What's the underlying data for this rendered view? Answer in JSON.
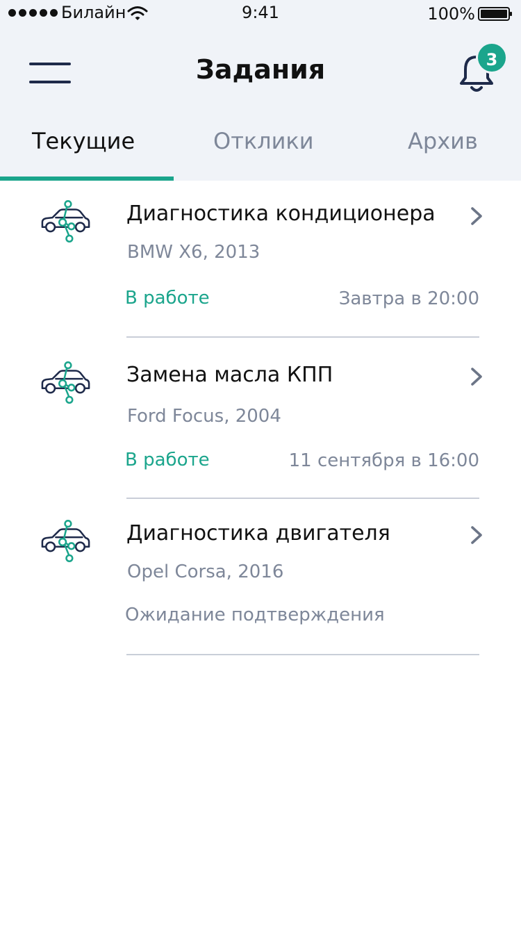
{
  "status_bar": {
    "carrier": "Билайн",
    "time": "9:41",
    "battery": "100%"
  },
  "header": {
    "title": "Задания",
    "notification_count": "3"
  },
  "tabs": [
    {
      "label": "Текущие",
      "active": true
    },
    {
      "label": "Отклики",
      "active": false
    },
    {
      "label": "Архив",
      "active": false
    }
  ],
  "tasks": [
    {
      "title": "Диагностика кондиционера",
      "car": "BMW X6, 2013",
      "status": "В работе",
      "time": "Завтра в 20:00",
      "icon": "car-diagnostics-icon"
    },
    {
      "title": "Замена масла КПП",
      "car": "Ford Focus, 2004",
      "status": "В работе",
      "time": "11 сентября в 16:00",
      "icon": "car-diagnostics-icon"
    },
    {
      "title": "Диагностика двигателя",
      "car": "Opel Corsa, 2016",
      "status": "Ожидание подтверждения",
      "time": "",
      "icon": "car-diagnostics-icon"
    }
  ],
  "colors": {
    "accent": "#1ba58c",
    "header_bg": "#f0f3f8",
    "secondary_text": "#7e8799",
    "icon_dark": "#1e2a4a"
  }
}
